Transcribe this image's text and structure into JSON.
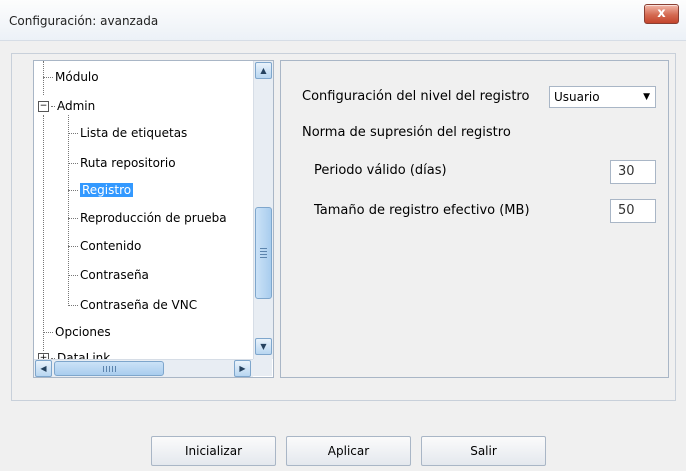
{
  "window": {
    "title": "Configuración: avanzada",
    "close_label": "x"
  },
  "tree": {
    "items": [
      {
        "label": "Módulo",
        "level": 0
      },
      {
        "label": "Admin",
        "level": 0,
        "expanded": true
      },
      {
        "label": "Lista de etiquetas",
        "level": 1
      },
      {
        "label": "Ruta repositorio",
        "level": 1
      },
      {
        "label": "Registro",
        "level": 1,
        "selected": true
      },
      {
        "label": "Reproducción de prueba",
        "level": 1
      },
      {
        "label": "Contenido",
        "level": 1
      },
      {
        "label": "Contraseña",
        "level": 1
      },
      {
        "label": "Contraseña de VNC",
        "level": 1
      },
      {
        "label": "Opciones",
        "level": 0
      },
      {
        "label": "DataLink",
        "level": 0
      }
    ],
    "expander_minus": "−",
    "expander_plus": "+"
  },
  "settings": {
    "log_level_label": "Configuración del nivel del registro",
    "log_level_value": "Usuario",
    "suppression_title": "Norma de supresión del registro",
    "valid_period_label": "Periodo válido (días)",
    "valid_period_value": "30",
    "effective_size_label": "Tamaño de registro efectivo (MB)",
    "effective_size_value": "50"
  },
  "buttons": {
    "initialize": "Inicializar",
    "apply": "Aplicar",
    "exit": "Salir"
  },
  "icons": {
    "close": "close-icon",
    "scroll_up": "chevron-up-icon",
    "scroll_down": "chevron-down-icon",
    "scroll_left": "chevron-left-icon",
    "scroll_right": "chevron-right-icon",
    "dropdown": "caret-down-icon"
  }
}
